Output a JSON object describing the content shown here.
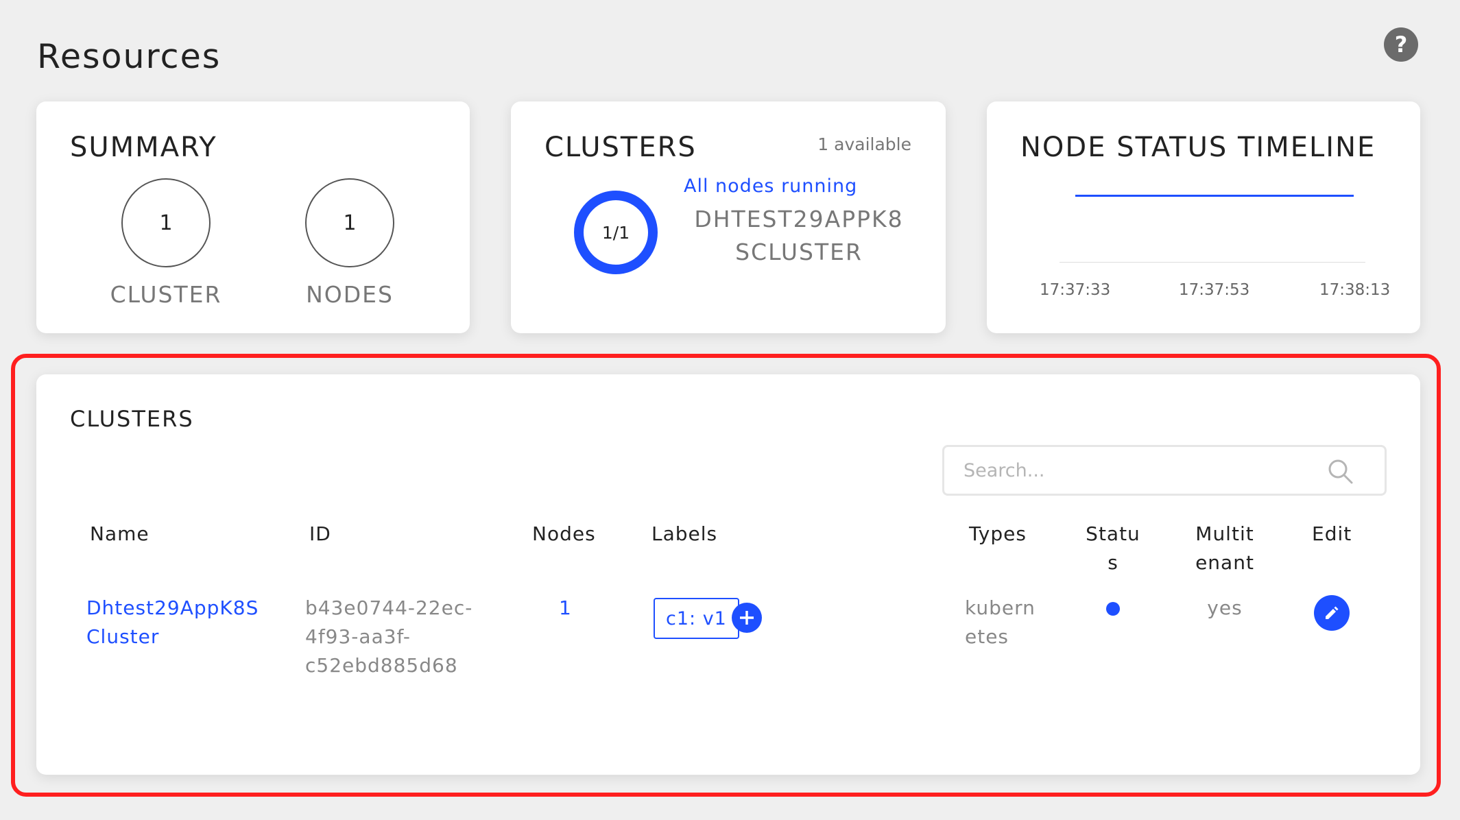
{
  "page": {
    "title": "Resources",
    "help_symbol": "?"
  },
  "summary": {
    "title": "SUMMARY",
    "items": [
      {
        "value": "1",
        "label": "CLUSTER"
      },
      {
        "value": "1",
        "label": "NODES"
      }
    ]
  },
  "clusters_card": {
    "title": "CLUSTERS",
    "available": "1 available",
    "ratio": "1/1",
    "status": "All nodes running",
    "cluster_name_line1": "DHTEST29APPK8",
    "cluster_name_line2": "SCLUSTER",
    "accent": "#1e4fff"
  },
  "timeline": {
    "title": "NODE STATUS TIMELINE",
    "ticks": [
      "17:37:33",
      "17:37:53",
      "17:38:13"
    ]
  },
  "table": {
    "title": "CLUSTERS",
    "search_placeholder": "Search...",
    "headers": {
      "name": "Name",
      "id": "ID",
      "nodes": "Nodes",
      "labels": "Labels",
      "types": "Types",
      "status_1": "Statu",
      "status_2": "s",
      "multitenant_1": "Multit",
      "multitenant_2": "enant",
      "edit": "Edit"
    },
    "rows": [
      {
        "name_1": "Dhtest29AppK8S",
        "name_2": "Cluster",
        "id_1": "b43e0744-22ec-",
        "id_2": "4f93-aa3f-",
        "id_3": "c52ebd885d68",
        "nodes": "1",
        "label": "c1: v1",
        "type_1": "kubern",
        "type_2": "etes",
        "status_icon": "status-dot-icon",
        "multitenant": "yes",
        "edit_icon": "pencil-icon"
      }
    ]
  },
  "highlight_color": "#ff1f1f"
}
